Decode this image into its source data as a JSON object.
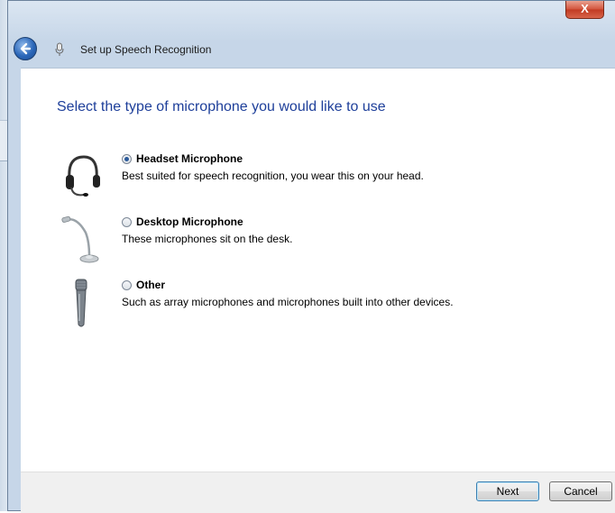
{
  "window": {
    "close_label": "X",
    "title": "Set up Speech Recognition"
  },
  "heading": "Select the type of microphone you would like to use",
  "options": [
    {
      "label": "Headset Microphone",
      "description": "Best suited for speech recognition, you wear this on your head.",
      "icon": "headset-icon",
      "selected": true
    },
    {
      "label": "Desktop Microphone",
      "description": "These microphones sit on the desk.",
      "icon": "desktop-microphone-icon",
      "selected": false
    },
    {
      "label": "Other",
      "description": "Such as array microphones and microphones built into other devices.",
      "icon": "handheld-microphone-icon",
      "selected": false
    }
  ],
  "footer": {
    "next_label": "Next",
    "cancel_label": "Cancel"
  },
  "colors": {
    "heading": "#1e3f9a",
    "accent": "#2b67b9"
  }
}
